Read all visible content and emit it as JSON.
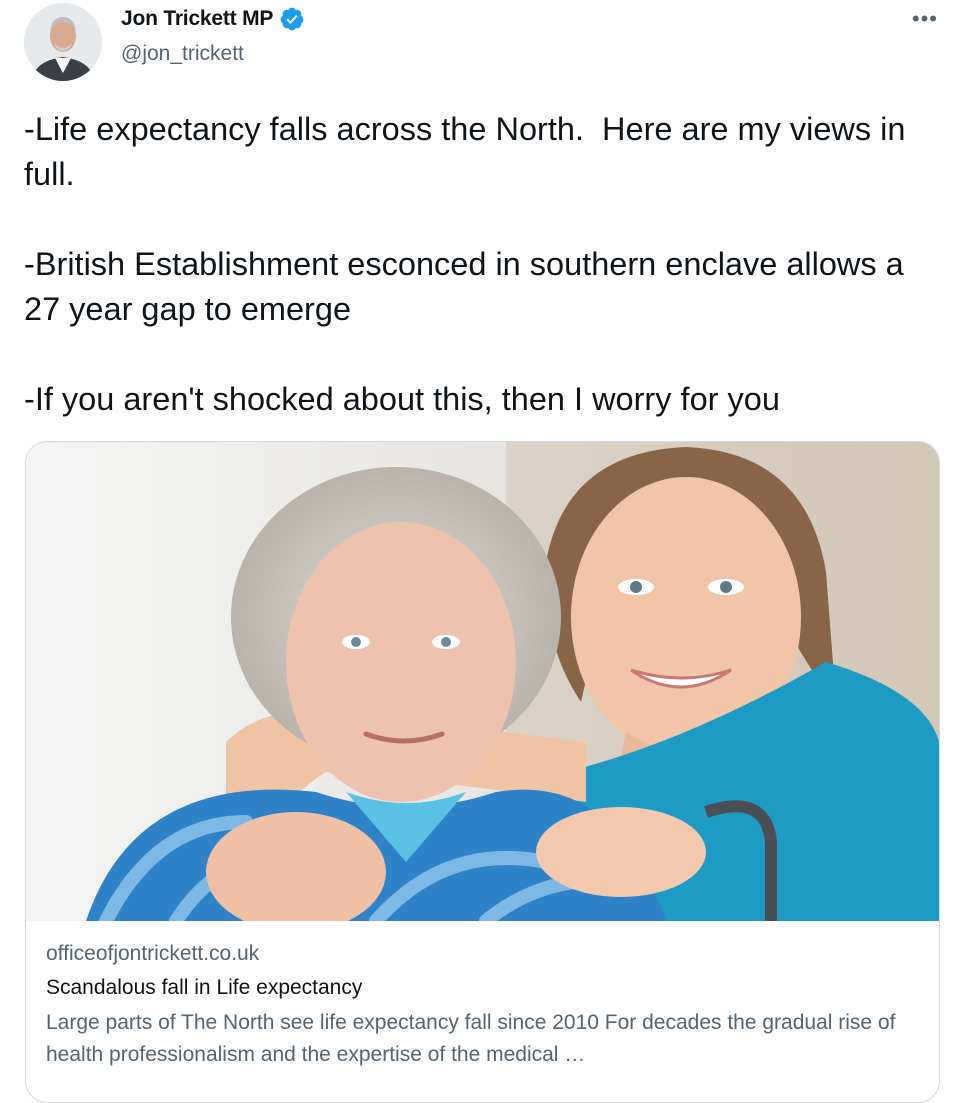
{
  "author": {
    "display_name": "Jon Trickett MP",
    "handle": "@jon_trickett",
    "verified_icon": "verified-badge-icon",
    "avatar_icon": "avatar"
  },
  "menu": {
    "more_label": "•••"
  },
  "tweet": {
    "paragraphs": [
      "-Life expectancy falls across the North.  Here are my views in full.",
      "-British Establishment esconced in southern enclave allows a 27 year gap to emerge",
      "-If you aren't shocked about this, then I worry for you"
    ]
  },
  "card": {
    "domain": "officeofjontrickett.co.uk",
    "title": "Scandalous fall in Life expectancy",
    "description": "Large parts of The North see life expectancy fall since 2010 For decades the gradual rise of health professionalism and the expertise of the medical …"
  },
  "colors": {
    "text_primary": "#0f1419",
    "text_secondary": "#536471",
    "verified_blue": "#1d9bf0",
    "border": "#cfd9de"
  }
}
